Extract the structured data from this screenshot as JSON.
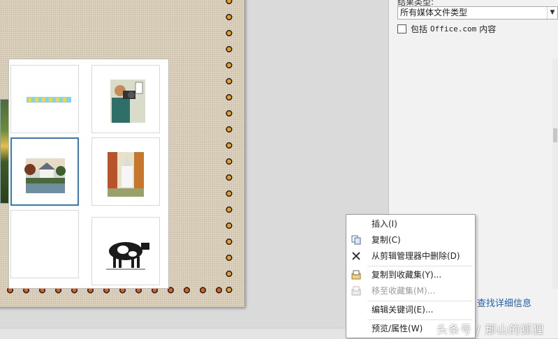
{
  "task_pane": {
    "result_type_label": "结果类型:",
    "media_type_value": "所有媒体文件类型",
    "include_office_prefix": "包括",
    "include_office_site": "Office.com",
    "include_office_suffix": "内容",
    "detail_link": "查找详细信息"
  },
  "context_menu": {
    "insert": "插入(I)",
    "copy": "复制(C)",
    "delete": "从剪辑管理器中删除(D)",
    "copy_to_collection": "复制到收藏集(Y)...",
    "move_to_collection": "移至收藏集(M)...",
    "edit_keywords": "编辑关键词(E)...",
    "preview_properties": "预览/属性(W)"
  },
  "watermark": "头条号 / 那山的狐狸",
  "icons": [
    "copy-icon",
    "delete-x-icon",
    "collection-icon",
    "move-collection-icon",
    "dropdown-arrow-icon"
  ]
}
